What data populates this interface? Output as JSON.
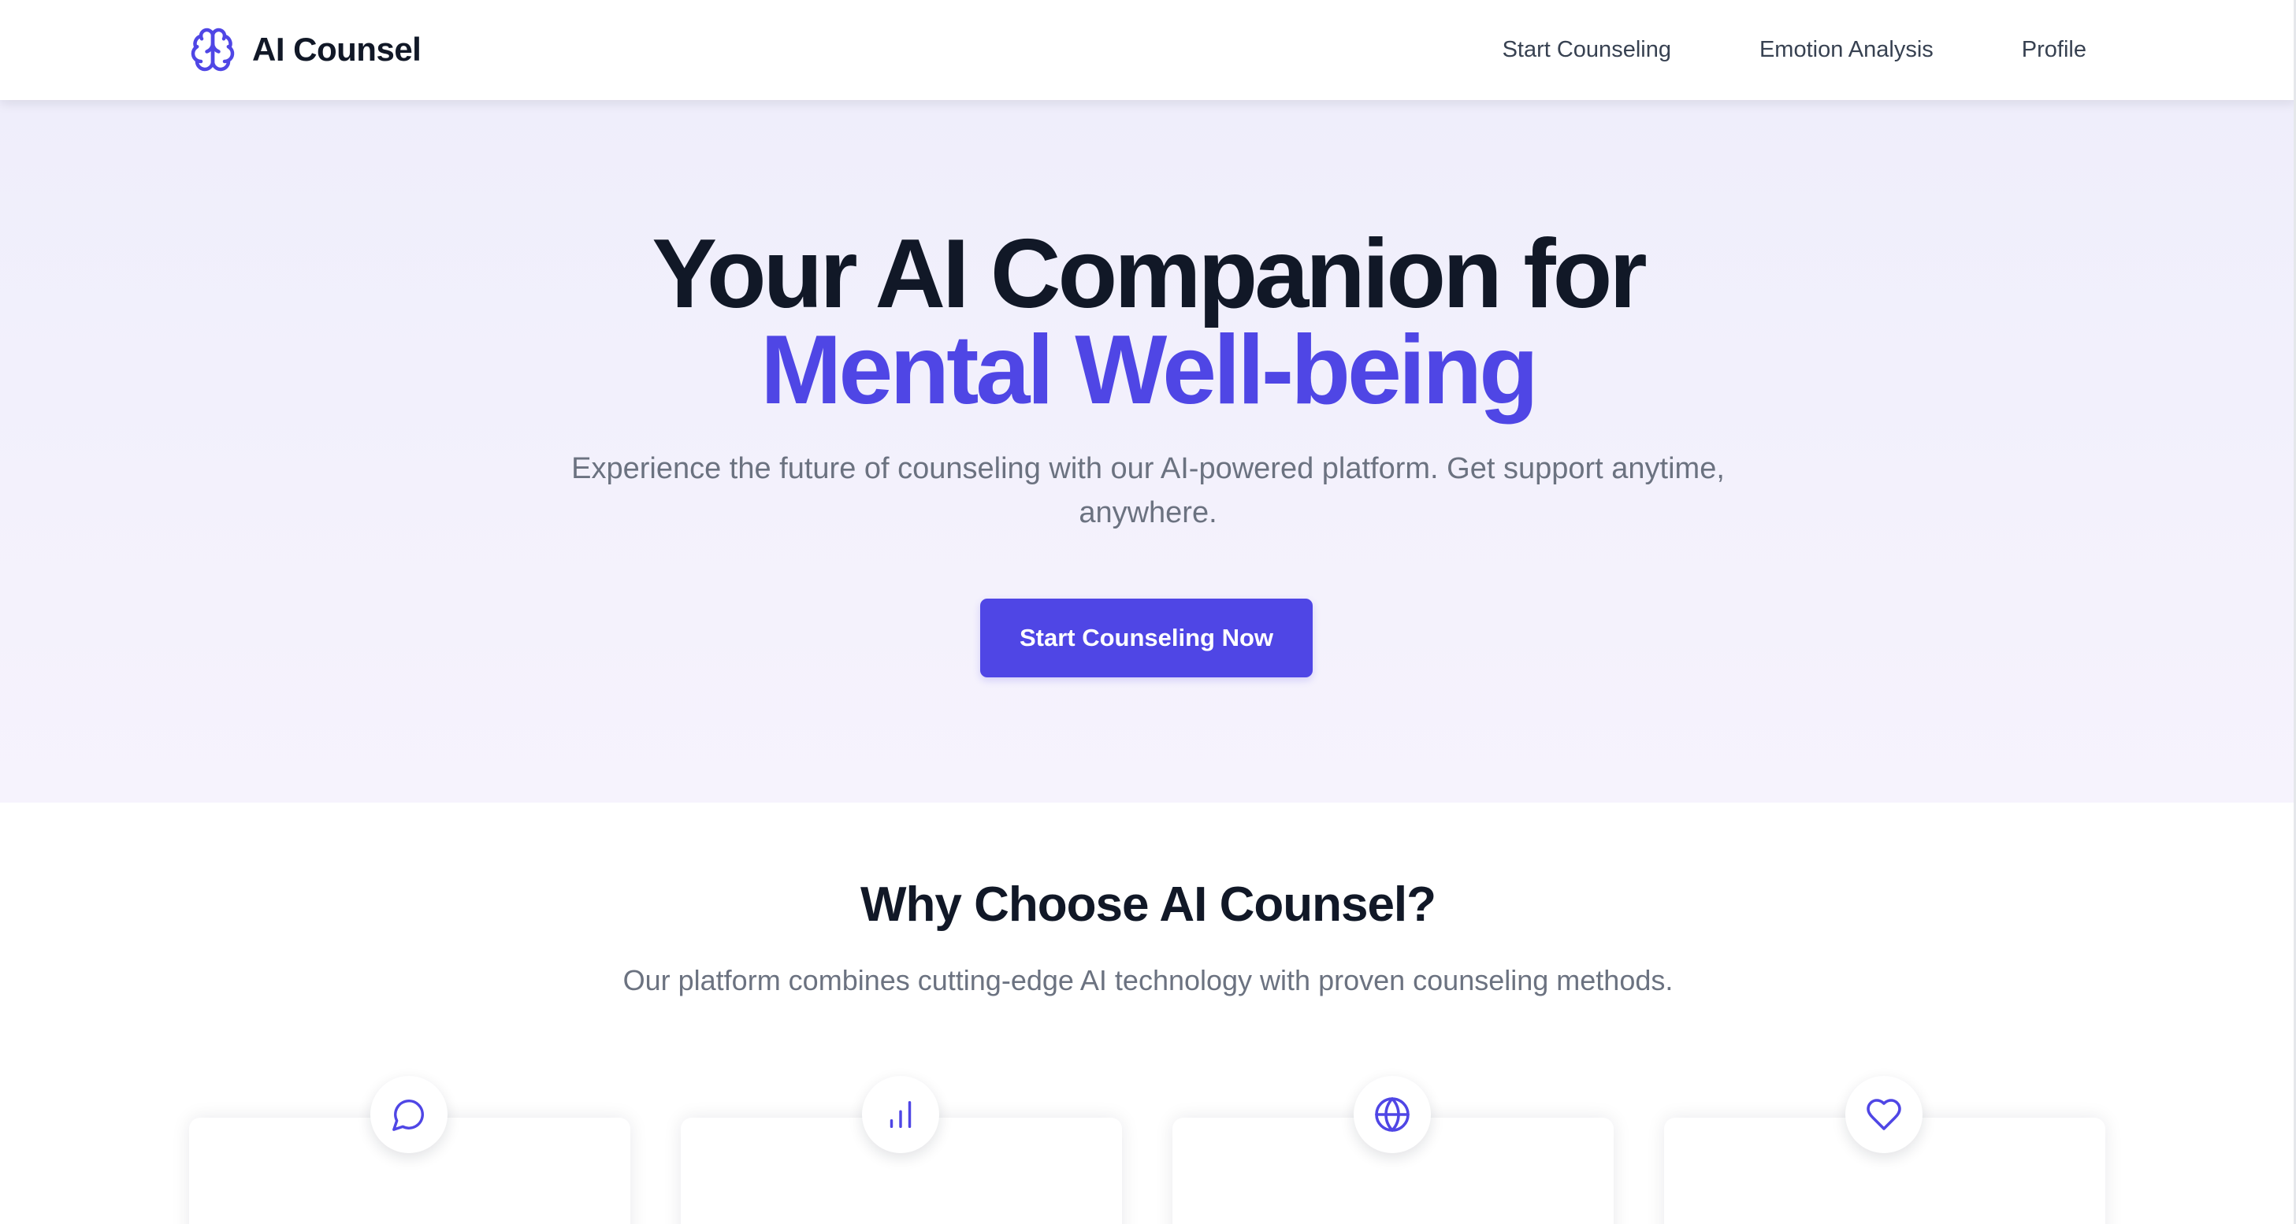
{
  "navbar": {
    "brand_name": "AI Counsel",
    "brand_icon": "brain-icon",
    "links": [
      {
        "label": "Start Counseling"
      },
      {
        "label": "Emotion Analysis"
      },
      {
        "label": "Profile"
      }
    ]
  },
  "hero": {
    "title_line1": "Your AI Companion for",
    "title_line2": "Mental Well-being",
    "subtitle": "Experience the future of counseling with our AI-powered platform. Get support anytime, anywhere.",
    "cta_label": "Start Counseling Now"
  },
  "features": {
    "title": "Why Choose AI Counsel?",
    "subtitle": "Our platform combines cutting-edge AI technology with proven counseling methods.",
    "cards": [
      {
        "icon": "message-circle-icon"
      },
      {
        "icon": "bar-chart-icon"
      },
      {
        "icon": "globe-icon"
      },
      {
        "icon": "heart-icon"
      }
    ]
  },
  "colors": {
    "accent": "#4f46e5",
    "heading": "#111827",
    "body_text": "#6b7280",
    "nav_text": "#374151",
    "hero_bg": "#f2f0fc"
  }
}
